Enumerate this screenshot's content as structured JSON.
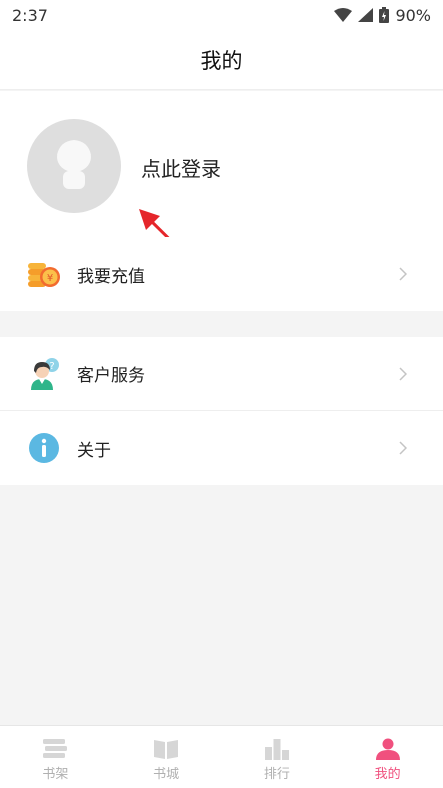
{
  "status": {
    "time": "2:37",
    "battery": "90%"
  },
  "header": {
    "title": "我的"
  },
  "profile": {
    "login_text": "点此登录"
  },
  "menu_top": [
    {
      "label": "我要充值",
      "icon": "coin-icon"
    }
  ],
  "menu_bottom": [
    {
      "label": "客户服务",
      "icon": "customer-service-icon"
    },
    {
      "label": "关于",
      "icon": "info-icon"
    }
  ],
  "tabs": [
    {
      "label": "书架",
      "icon": "bookshelf-icon",
      "active": false
    },
    {
      "label": "书城",
      "icon": "bookstore-icon",
      "active": false
    },
    {
      "label": "排行",
      "icon": "ranking-icon",
      "active": false
    },
    {
      "label": "我的",
      "icon": "profile-icon",
      "active": true
    }
  ],
  "colors": {
    "accent": "#f0507e",
    "inactive": "#b0b0b0",
    "arrow": "#e5262b"
  }
}
